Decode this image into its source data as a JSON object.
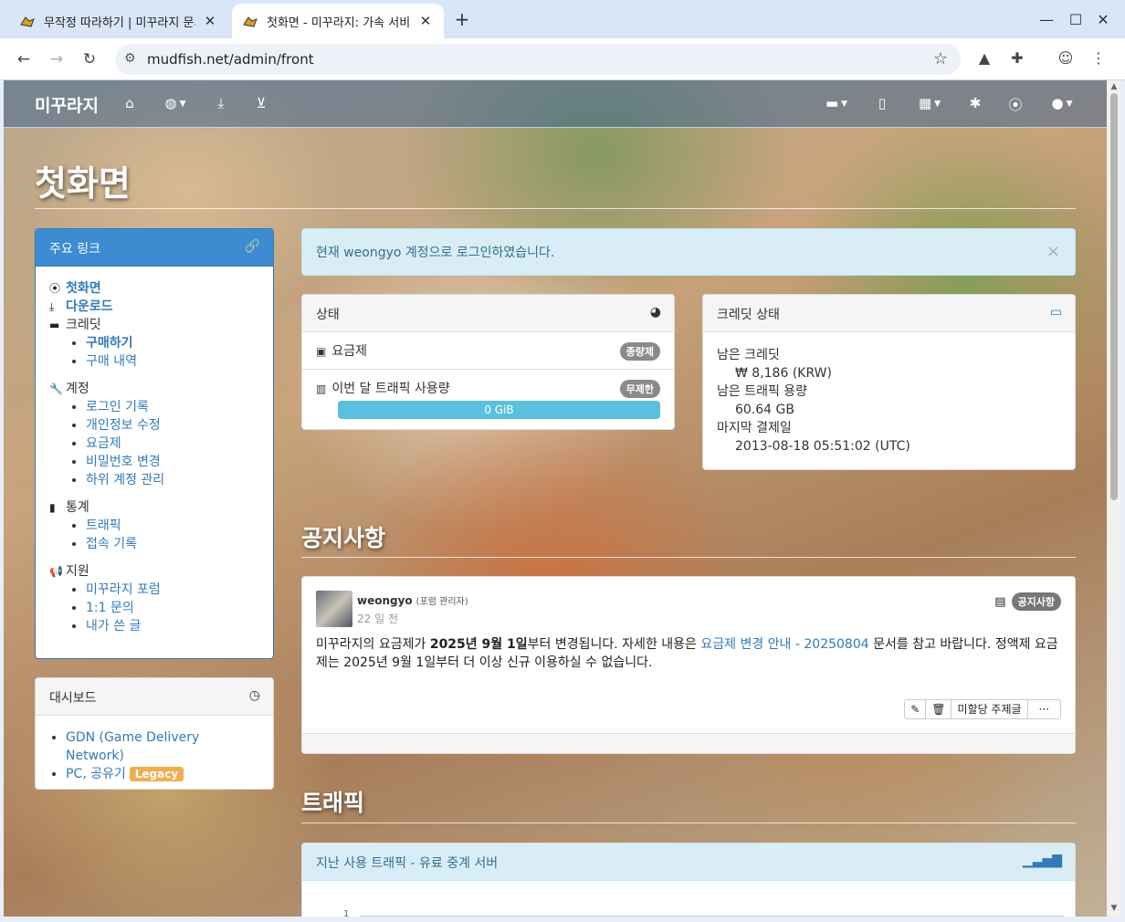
{
  "browser": {
    "tabs": [
      {
        "title": "무작정 따라하기 | 미꾸라지 문서",
        "active": false
      },
      {
        "title": "첫화면 - 미꾸라지: 가속 서비스",
        "active": true
      }
    ],
    "url": "mudfish.net/admin/front"
  },
  "navbar": {
    "brand": "미꾸라지",
    "icons": [
      "home-icon",
      "globe-icon",
      "download-icon",
      "cart-icon",
      "comment-icon",
      "book-icon",
      "grid-icon",
      "asterisk-icon",
      "map-marker-icon",
      "user-icon"
    ]
  },
  "page": {
    "title": "첫화면"
  },
  "sidebar": {
    "links_title": "주요 링크",
    "home": "첫화면",
    "download": "다운로드",
    "credit": "크레딧",
    "credit_items": [
      "구매하기",
      "구매 내역"
    ],
    "account": "계정",
    "account_items": [
      "로그인 기록",
      "개인정보 수정",
      "요금제",
      "비밀번호 변경",
      "하위 계정 관리"
    ],
    "stats": "통계",
    "stats_items": [
      "트래픽",
      "접속 기록"
    ],
    "support": "지원",
    "support_items": [
      "미꾸라지 포럼",
      "1:1 문의",
      "내가 쓴 글"
    ],
    "dashboard_title": "대시보드",
    "dashboard_items": [
      "GDN (Game Delivery Network)",
      "PC, 공유기"
    ],
    "legacy_label": "Legacy"
  },
  "alert": {
    "text": "현재 weongyo 계정으로 로그인하였습니다.",
    "close": "×"
  },
  "status": {
    "title": "상태",
    "plan_label": "요금제",
    "plan_badge": "종량제",
    "traffic_label": "이번 달 트래픽 사용량",
    "traffic_badge": "무제한",
    "traffic_value": "0 GiB",
    "traffic_fill_fraction": 1.0
  },
  "credit": {
    "title": "크레딧 상태",
    "remaining_credit_label": "남은 크레딧",
    "remaining_credit_value": "₩ 8,186 (KRW)",
    "remaining_traffic_label": "남은 트래픽 용량",
    "remaining_traffic_value": "60.64 GB",
    "last_payment_label": "마지막 결제일",
    "last_payment_value": "2013-08-18 05:51:02 (UTC)"
  },
  "notice": {
    "section_title": "공지사항",
    "user": "weongyo",
    "role": "(포럼 관리자)",
    "time": "22 일 전",
    "tag": "공지사항",
    "text_1": "미꾸라지의 요금제가 ",
    "text_bold": "2025년 9월 1일",
    "text_2": "부터 변경됩니다. 자세한 내용은 ",
    "text_link": "요금제 변경 안내 - 20250804",
    "text_3": " 문서를 참고 바랍니다. 정액제 요금제는 2025년 9월 1일부터 더 이상 신규 이용하실 수 없습니다.",
    "btn_unassigned": "미할당 주제글",
    "btn_more": "···"
  },
  "traffic": {
    "section_title": "트래픽",
    "panel_title": "지난 사용 트래픽 - 유료 중계 서버",
    "axis_tick": "1"
  }
}
